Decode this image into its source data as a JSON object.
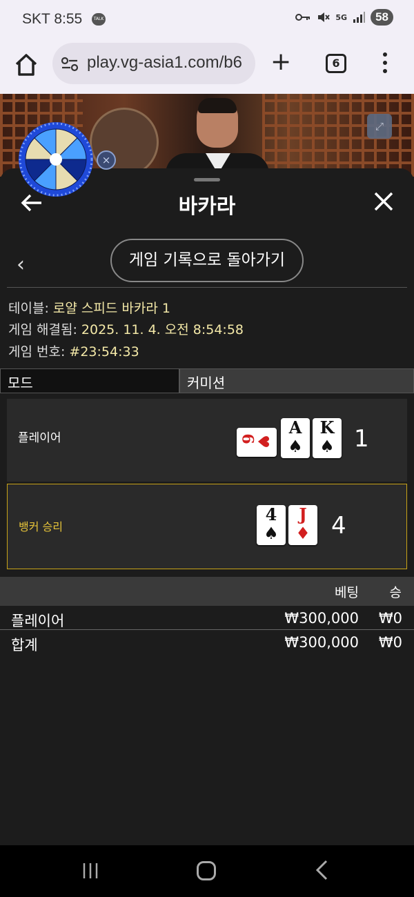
{
  "status_bar": {
    "carrier": "SKT",
    "time": "8:55",
    "talk_badge": "TALK",
    "network": "5G",
    "battery": "58"
  },
  "browser": {
    "url": "play.vg-asia1.com/b6",
    "tab_count": "6",
    "plus_label": "+"
  },
  "sheet": {
    "title": "바카라",
    "history_button": "게임 기록으로 돌아가기",
    "info": [
      {
        "label": "테이블: ",
        "value": "로얄 스피드 바카라 1"
      },
      {
        "label": "게임 해결됨: ",
        "value": "2025. 11. 4. 오전 8:54:58"
      },
      {
        "label": "게임 번호: ",
        "value": "#23:54:33"
      }
    ],
    "mode": {
      "label": "모드",
      "value": "커미션"
    },
    "player": {
      "label": "플레이어",
      "cards": [
        {
          "rank": "6",
          "suit": "♥",
          "color": "red",
          "sideways": true
        },
        {
          "rank": "A",
          "suit": "♠",
          "color": "black"
        },
        {
          "rank": "K",
          "suit": "♠",
          "color": "black"
        }
      ],
      "score": "1"
    },
    "banker": {
      "label": "뱅커 승리",
      "cards": [
        {
          "rank": "4",
          "suit": "♠",
          "color": "black"
        },
        {
          "rank": "J",
          "suit": "♦",
          "color": "red"
        }
      ],
      "score": "4",
      "highlight_color": "#c9a418"
    },
    "bets": {
      "header_bet": "베팅",
      "header_win": "승",
      "rows": [
        {
          "label": "플레이어",
          "bet": "₩300,000",
          "win": "₩0"
        },
        {
          "label": "합계",
          "bet": "₩300,000",
          "win": "₩0"
        }
      ]
    }
  },
  "colors": {
    "accent": "#f4e9a8",
    "banker_label": "#e8c53a",
    "sheet_bg": "#1c1c1c"
  }
}
